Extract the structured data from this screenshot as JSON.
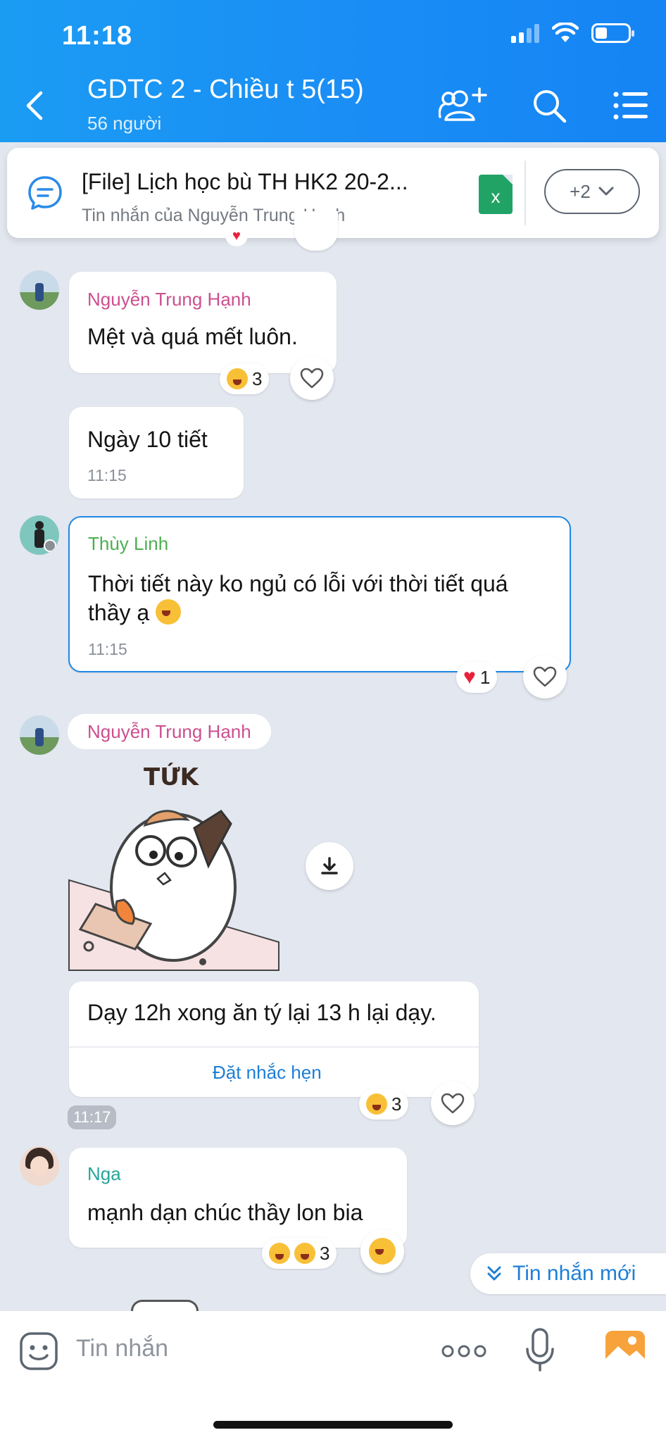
{
  "status_bar": {
    "time": "11:18"
  },
  "header": {
    "title": "GDTC 2 - Chiều t 5(15)",
    "member_count": "56 người"
  },
  "pinned": {
    "title": "[File] Lịch học bù TH HK2 20-2...",
    "subtitle": "Tin nhắn của Nguyễn Trung Hạnh",
    "file_icon_letter": "x",
    "more_count": "+2"
  },
  "messages": [
    {
      "sender": "Nguyễn Trung Hạnh",
      "text": "Mệt và quá mết luôn.",
      "reaction_count": "3"
    },
    {
      "text": "Ngày 10 tiết",
      "time": "11:15"
    },
    {
      "sender": "Thùy Linh",
      "text_line1": "Thời tiết này ko ngủ có lỗi với thời tiết quá",
      "text_line2": "thầy ạ",
      "time": "11:15",
      "reaction_count": "1"
    },
    {
      "sender": "Nguyễn Trung Hạnh",
      "sticker_text": "TỨK"
    },
    {
      "text": "Dạy 12h xong ăn tý lại 13 h lại dạy.",
      "action": "Đặt nhắc hẹn",
      "reaction_count": "3",
      "time": "11:17"
    },
    {
      "sender": "Nga",
      "text": "mạnh dạn chúc thầy lon bia",
      "reaction_count": "3"
    }
  ],
  "new_messages_button": "Tin nhắn mới",
  "input": {
    "placeholder": "Tin nhắn"
  },
  "colors": {
    "header_blue": "#1a8ef5",
    "sender_pink": "#cc4f8f",
    "sender_green": "#4caf50",
    "sender_teal": "#26a69a",
    "link_blue": "#1e7fd6"
  }
}
